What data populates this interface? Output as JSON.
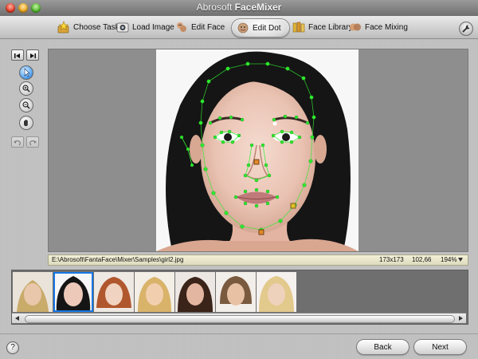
{
  "window": {
    "title_prefix": "Abrosoft ",
    "title_bold": "FaceMixer"
  },
  "toolbar": {
    "tabs": [
      {
        "label": "Choose Task",
        "icon": "star-folder-icon"
      },
      {
        "label": "Load Image",
        "icon": "load-image-icon"
      },
      {
        "label": "Edit Face",
        "icon": "edit-face-icon"
      },
      {
        "label": "Edit Dot",
        "icon": "edit-dot-icon",
        "active": true
      },
      {
        "label": "Face Library",
        "icon": "face-library-icon"
      },
      {
        "label": "Face Mixing",
        "icon": "face-mixing-icon"
      }
    ],
    "settings_icon": "wrench-icon"
  },
  "status": {
    "path": "E:\\Abrosoft\\FantaFace\\Mixer\\Samples\\girl2.jpg",
    "dimensions": "173x173",
    "coordinates": "102,66",
    "zoom": "194%"
  },
  "thumbnails": {
    "count": 7,
    "selected_index": 1
  },
  "footer": {
    "help_label": "?",
    "back_label": "Back",
    "next_label": "Next"
  },
  "colors": {
    "accent": "#1677e4",
    "dot": "#2eea2e",
    "handle": "#e08a2a"
  }
}
